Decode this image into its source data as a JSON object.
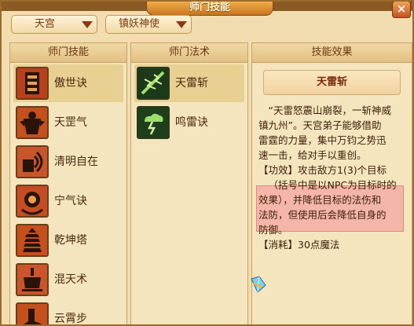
{
  "window": {
    "title": "师门技能",
    "close_label": "×"
  },
  "filters": {
    "sect": "天宫",
    "role": "镇妖神使"
  },
  "columns": {
    "skills": "师门技能",
    "spells": "师门法术",
    "effect": "技能效果"
  },
  "skills": [
    {
      "label": "傲世诀",
      "icon": "pillar-icon"
    },
    {
      "label": "天罡气",
      "icon": "warrior-icon"
    },
    {
      "label": "清明自在",
      "icon": "signal-icon"
    },
    {
      "label": "宁气诀",
      "icon": "orb-icon"
    },
    {
      "label": "乾坤塔",
      "icon": "pagoda-icon"
    },
    {
      "label": "混天术",
      "icon": "cauldron-icon"
    },
    {
      "label": "云霄步",
      "icon": "boot-icon"
    }
  ],
  "spells": [
    {
      "label": "天雷斩",
      "icon": "thunder-blade-icon"
    },
    {
      "label": "鸣雷诀",
      "icon": "thunder-cloud-icon"
    }
  ],
  "effect": {
    "name": "天雷斩",
    "lines": [
      "“天雷怒震山崩裂，一斩神威",
      "镇九州”。天宫弟子能够借助",
      "雷霆的力量，集中万钧之势迅",
      "速一击，给对手以重创。",
      "【功效】攻击敌方1(3)个目标",
      "（括号中是以NPC为目标时的",
      "效果），并降低目标的法伤和",
      "法防，但使用后会降低自身的",
      "防御。",
      "【消耗】30点魔法"
    ]
  },
  "colors": {
    "accent": "#7a3a10",
    "highlight": "#f4b6a8",
    "selected": "#e8cf92"
  }
}
